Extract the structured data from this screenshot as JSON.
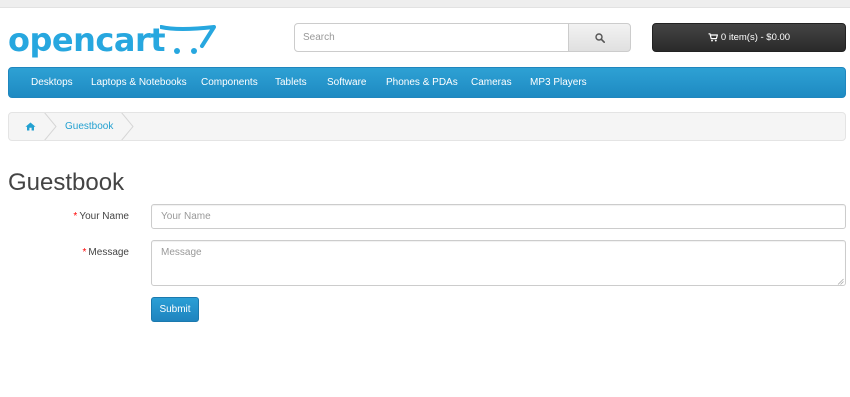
{
  "brand": {
    "name": "opencart",
    "color": "#27a7df"
  },
  "search": {
    "placeholder": "Search",
    "button_icon": "search-icon"
  },
  "cart": {
    "icon": "shopping-cart-icon",
    "label": "0 item(s) - $0.00"
  },
  "menu": {
    "items": [
      "Desktops",
      "Laptops & Notebooks",
      "Components",
      "Tablets",
      "Software",
      "Phones & PDAs",
      "Cameras",
      "MP3 Players"
    ]
  },
  "breadcrumb": {
    "home_icon": "home-icon",
    "items": [
      "Guestbook"
    ]
  },
  "page": {
    "title": "Guestbook"
  },
  "form": {
    "required_marker": "*",
    "name_label": "Your Name",
    "name_placeholder": "Your Name",
    "message_label": "Message",
    "message_placeholder": "Message",
    "submit_label": "Submit"
  },
  "colors": {
    "accent": "#229ac8",
    "link": "#23a1d1",
    "cart_bg": "#333333",
    "required": "#ff0000"
  }
}
